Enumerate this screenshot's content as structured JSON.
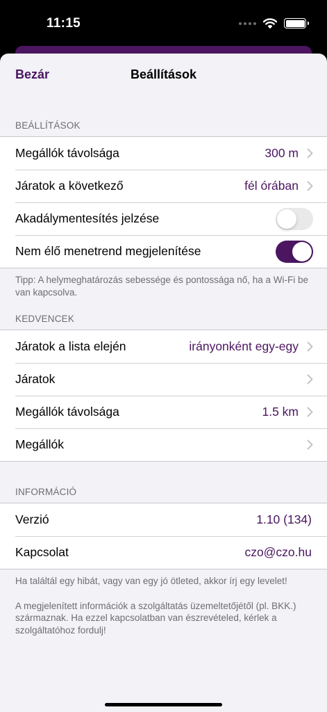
{
  "status_bar": {
    "time": "11:15"
  },
  "nav": {
    "close_label": "Bezár",
    "title": "Beállítások"
  },
  "settings": {
    "header": "BEÁLLÍTÁSOK",
    "rows": [
      {
        "label": "Megállók távolsága",
        "value": "300 m"
      },
      {
        "label": "Járatok a következő",
        "value": "fél órában"
      },
      {
        "label": "Akadálymentesítés jelzése",
        "toggle": false
      },
      {
        "label": "Nem élő menetrend megjelenítése",
        "toggle": true
      }
    ],
    "footer": "Tipp: A helymeghatározás sebessége és pontossága nő, ha a Wi-Fi be van kapcsolva."
  },
  "favorites": {
    "header": "KEDVENCEK",
    "rows": [
      {
        "label": "Járatok a lista elején",
        "value": "irányonként egy-egy"
      },
      {
        "label": "Járatok",
        "value": ""
      },
      {
        "label": "Megállók távolsága",
        "value": "1.5 km"
      },
      {
        "label": "Megállók",
        "value": ""
      }
    ]
  },
  "info": {
    "header": "INFORMÁCIÓ",
    "rows": [
      {
        "label": "Verzió",
        "value": "1.10 (134)"
      },
      {
        "label": "Kapcsolat",
        "value": "czo@czo.hu"
      }
    ],
    "footer_1": "Ha találtál egy hibát, vagy van egy jó ötleted, akkor írj egy levelet!",
    "footer_2": "A megjelenített információk a szolgáltatás üzemeltetőjétől (pl. BKK.) származnak. Ha ezzel kapcsolatban van észrevételed, kérlek a szolgáltatóhoz fordulj!"
  },
  "colors": {
    "accent": "#4b1560",
    "background": "#f2f2f7",
    "secondary_text": "#6d6d72",
    "chevron": "#c4c4c7"
  }
}
